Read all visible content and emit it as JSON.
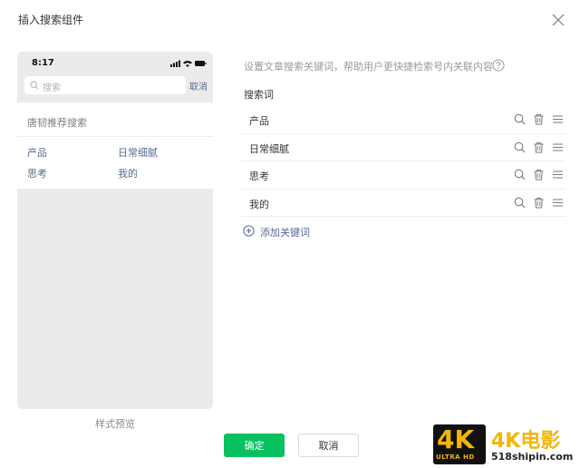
{
  "dialog": {
    "title": "插入搜索组件",
    "close_icon": "close-icon"
  },
  "preview": {
    "status_time": "8:17",
    "search_placeholder": "搜索",
    "search_cancel": "取消",
    "recommend_title": "唐韧推荐搜索",
    "keywords": [
      "产品",
      "日常细腻",
      "思考",
      "我的"
    ],
    "caption": "样式预览"
  },
  "settings": {
    "description": "设置文章搜索关键词，帮助用户更快捷检索号内关联内容",
    "label": "搜索词",
    "keywords": [
      {
        "text": "产品"
      },
      {
        "text": "日常细腻"
      },
      {
        "text": "思考"
      },
      {
        "text": "我的"
      }
    ],
    "add_label": "添加关键词"
  },
  "footer": {
    "confirm_label": "确定",
    "cancel_label": "取消"
  },
  "watermark": {
    "badge": "4K",
    "badge_sub": "ULTRA HD",
    "brand": "4K电影",
    "site": "518shipin.com"
  },
  "colors": {
    "accent_green": "#07c160",
    "link_blue": "#576b95",
    "preview_bg": "#ebebeb"
  }
}
